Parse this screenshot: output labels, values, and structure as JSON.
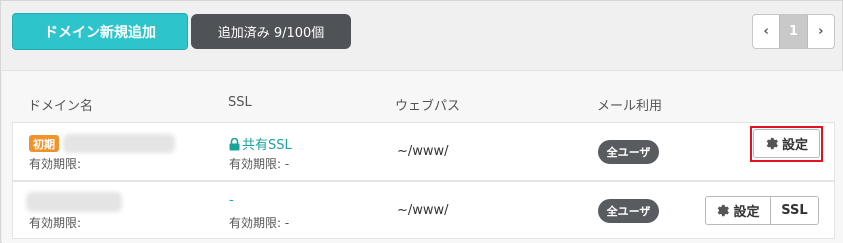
{
  "toolbar": {
    "add_domain_label": "ドメイン新規追加",
    "count_label": "追加済み 9/100個"
  },
  "pager": {
    "prev": "‹",
    "current": "1",
    "next": "›"
  },
  "table": {
    "headers": [
      "ドメイン名",
      "SSL",
      "ウェブパス",
      "メール利用"
    ],
    "rows": [
      {
        "badge": "初期",
        "expiry_label": "有効期限:",
        "ssl": "共有SSL",
        "ssl_expiry": "有効期限: -",
        "web_path": "~/www/",
        "mail": "全ユーザ",
        "settings_label": "設定"
      },
      {
        "expiry_label": "有効期限:",
        "ssl": "-",
        "ssl_expiry": "有効期限: -",
        "web_path": "~/www/",
        "mail": "全ユーザ",
        "settings_label": "設定",
        "ssl_button_label": "SSL"
      }
    ]
  },
  "colors": {
    "primary": "#2ec4cc",
    "dark_button": "#4f5257",
    "badge_orange": "#f0932b",
    "ssl_green": "#1aa39a",
    "highlight_red": "#e0141e"
  }
}
